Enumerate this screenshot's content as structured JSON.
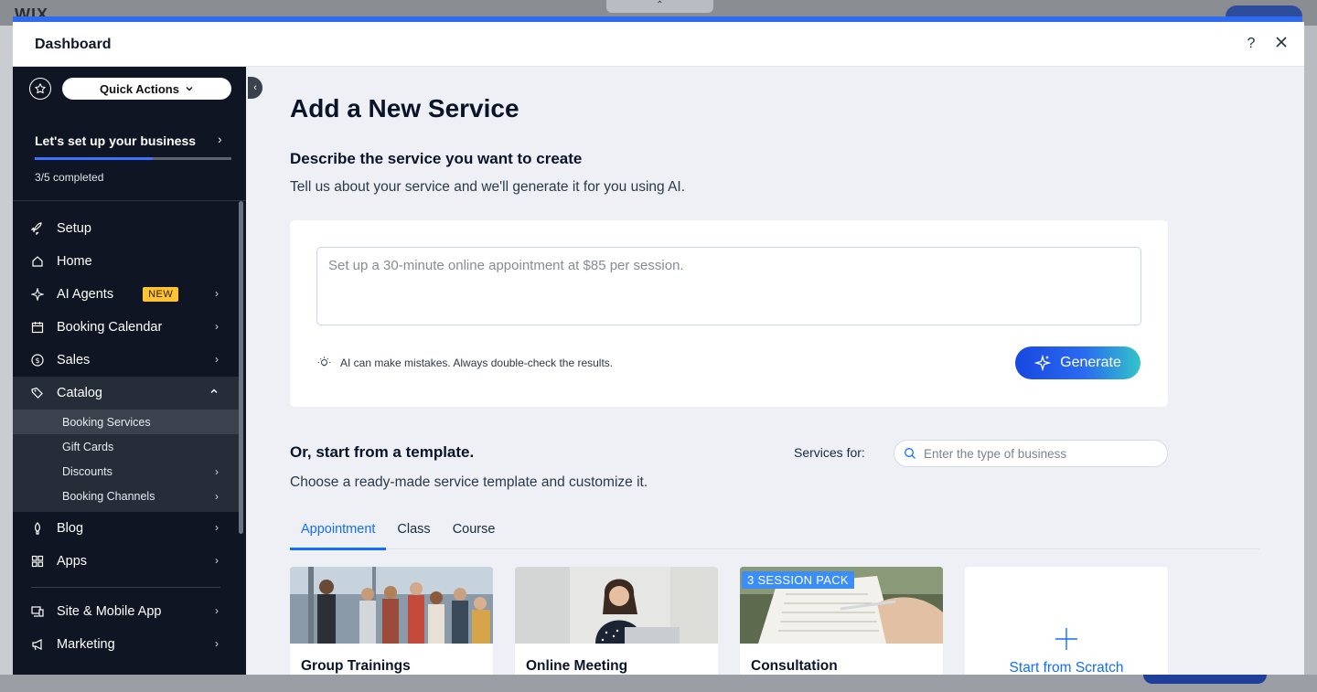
{
  "background": {
    "logo": "WIX"
  },
  "modal": {
    "title": "Dashboard",
    "help_icon": "question-mark-icon",
    "close_icon": "close-icon"
  },
  "sidebar": {
    "quick_actions": "Quick Actions",
    "setup": {
      "title": "Let's set up your business",
      "progress_text": "3/5 completed",
      "progress_fraction": 0.6
    },
    "items": [
      {
        "id": "setup",
        "label": "Setup",
        "icon": "rocket-icon",
        "chevron": false
      },
      {
        "id": "home",
        "label": "Home",
        "icon": "home-icon",
        "chevron": false
      },
      {
        "id": "ai-agents",
        "label": "AI Agents",
        "icon": "sparkle-icon",
        "chevron": true,
        "badge": "NEW"
      },
      {
        "id": "booking-calendar",
        "label": "Booking Calendar",
        "icon": "calendar-icon",
        "chevron": true
      },
      {
        "id": "sales",
        "label": "Sales",
        "icon": "dollar-icon",
        "chevron": true
      },
      {
        "id": "catalog",
        "label": "Catalog",
        "icon": "tag-icon",
        "chevron": true,
        "expanded": true
      }
    ],
    "catalog_sub": [
      {
        "label": "Booking Services",
        "selected": true,
        "chevron": false
      },
      {
        "label": "Gift Cards",
        "selected": false,
        "chevron": false
      },
      {
        "label": "Discounts",
        "selected": false,
        "chevron": true
      },
      {
        "label": "Booking Channels",
        "selected": false,
        "chevron": true
      }
    ],
    "items_after": [
      {
        "id": "blog",
        "label": "Blog",
        "icon": "pen-icon"
      },
      {
        "id": "apps",
        "label": "Apps",
        "icon": "apps-icon"
      }
    ],
    "items_bottom": [
      {
        "id": "site-mobile",
        "label": "Site & Mobile App",
        "icon": "monitor-icon"
      },
      {
        "id": "marketing",
        "label": "Marketing",
        "icon": "megaphone-icon"
      }
    ]
  },
  "main": {
    "page_title": "Add a New Service",
    "describe_title": "Describe the service you want to create",
    "describe_desc": "Tell us about your service and we'll generate it for you using AI.",
    "ai_input_placeholder": "Set up a 30-minute online appointment at $85 per session.",
    "ai_input_value": "",
    "ai_note": "AI can make mistakes. Always double-check the results.",
    "generate_label": "Generate",
    "template_title": "Or, start from a template.",
    "template_desc": "Choose a ready-made service template and customize it.",
    "services_for_label": "Services for:",
    "search_placeholder": "Enter the type of business",
    "tabs": [
      {
        "label": "Appointment",
        "active": true
      },
      {
        "label": "Class",
        "active": false
      },
      {
        "label": "Course",
        "active": false
      }
    ],
    "cards": [
      {
        "title": "Group Trainings",
        "image": "group-photo",
        "badge": ""
      },
      {
        "title": "Online Meeting",
        "image": "woman-laptop-photo",
        "badge": ""
      },
      {
        "title": "Consultation",
        "image": "notes-photo",
        "badge": "3 SESSION PACK"
      }
    ],
    "scratch_label": "Start from Scratch"
  },
  "colors": {
    "accent": "#116dff",
    "sidebar_bg": "#0f1522",
    "badge_new": "#ffc233"
  }
}
